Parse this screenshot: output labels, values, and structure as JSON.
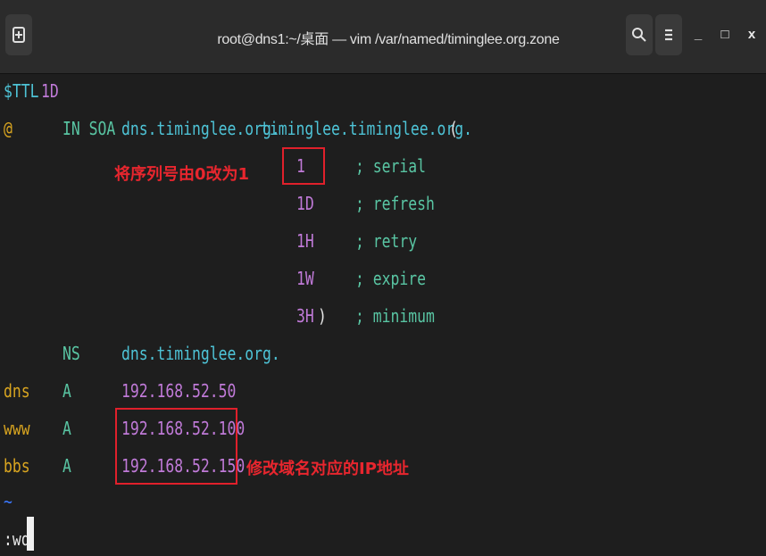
{
  "window": {
    "title": "root@dns1:~/桌面 — vim /var/named/timinglee.org.zone",
    "buttons": [
      "new-tab",
      "search",
      "menu",
      "minimize",
      "maximize",
      "close"
    ]
  },
  "window_controls": {
    "minimize": "_",
    "maximize": "□",
    "close": "x"
  },
  "editor": {
    "line1": {
      "directive": "$TTL",
      "value": "1D"
    },
    "line2": {
      "origin": "@",
      "class_type": "IN SOA",
      "ns": "dns.timinglee.org.",
      "email": "timinglee.timinglee.org.",
      "paren": "("
    },
    "soa_values": [
      {
        "value": "1",
        "comment": "; serial"
      },
      {
        "value": "1D",
        "comment": "; refresh"
      },
      {
        "value": "1H",
        "comment": "; retry"
      },
      {
        "value": "1W",
        "comment": "; expire"
      },
      {
        "value": "3H",
        "close": ")",
        "comment": "; minimum"
      }
    ],
    "ns_record": {
      "type": "NS",
      "value": "dns.timinglee.org."
    },
    "a_records": [
      {
        "name": "dns",
        "type": "A",
        "ip": "192.168.52.50"
      },
      {
        "name": "www",
        "type": "A",
        "ip": "192.168.52.100"
      },
      {
        "name": "bbs",
        "type": "A",
        "ip": "192.168.52.150"
      }
    ],
    "tilde": "~",
    "command": ":wq"
  },
  "annotations": {
    "serial_note": "将序列号由0改为1",
    "ip_note": "修改域名对应的IP地址",
    "color": "#e8262e"
  },
  "colors": {
    "background": "#1e1e1e",
    "titlebar": "#2b2b2b",
    "cyan": "#4ec3d6",
    "purple": "#c07ad8",
    "yellow": "#d9a520",
    "green": "#59c5a3"
  }
}
